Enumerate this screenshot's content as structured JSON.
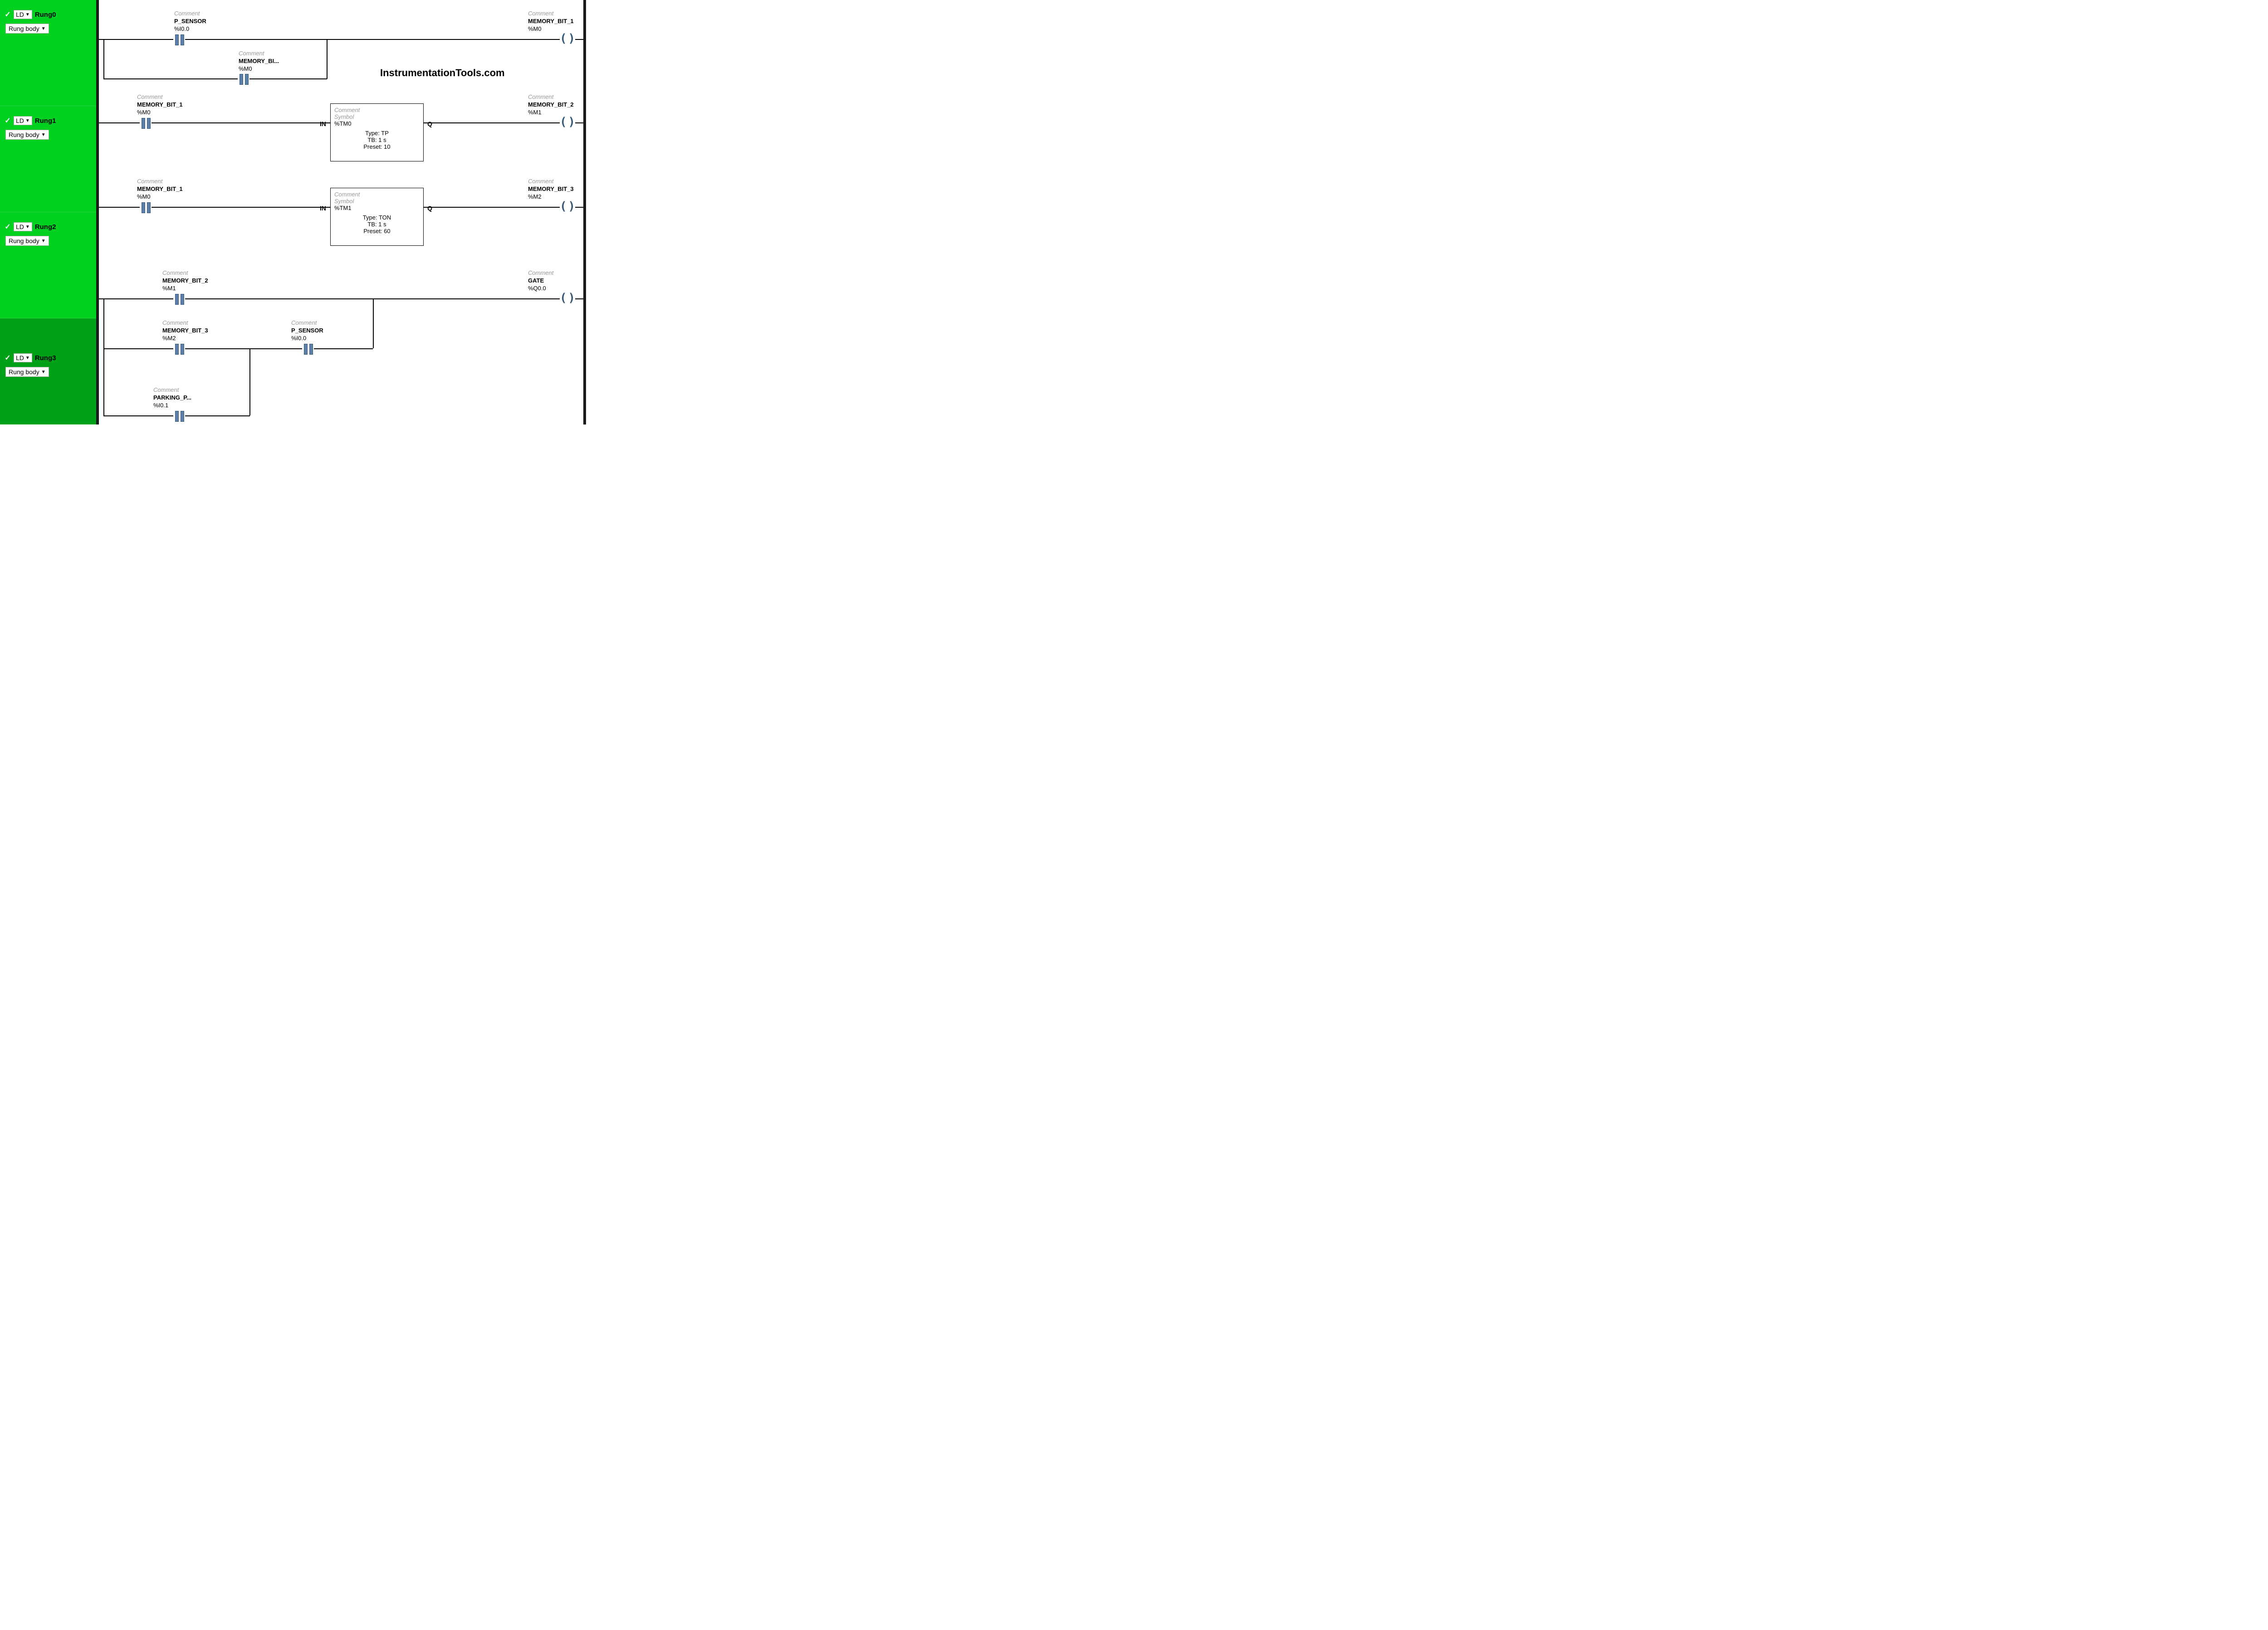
{
  "sidebar": {
    "ld_label": "LD",
    "body_label": "Rung body",
    "rungs": [
      {
        "name": "Rung0",
        "dark": false
      },
      {
        "name": "Rung1",
        "dark": false
      },
      {
        "name": "Rung2",
        "dark": false
      },
      {
        "name": "Rung3",
        "dark": true
      }
    ]
  },
  "watermark": "InstrumentationTools.com",
  "labels": {
    "comment": "Comment",
    "symbol": "Symbol"
  },
  "rung0": {
    "contact1": {
      "symbol": "P_SENSOR",
      "addr": "%I0.0"
    },
    "contact2": {
      "symbol": "MEMORY_BI...",
      "addr": "%M0"
    },
    "coil": {
      "symbol": "MEMORY_BIT_1",
      "addr": "%M0"
    }
  },
  "rung1": {
    "contact1": {
      "symbol": "MEMORY_BIT_1",
      "addr": "%M0"
    },
    "timer": {
      "addr": "%TM0",
      "type_line": "Type:  TP",
      "tb_line": "TB:  1 s",
      "preset_line": "Preset:  10",
      "in": "IN",
      "q": "Q"
    },
    "coil": {
      "symbol": "MEMORY_BIT_2",
      "addr": "%M1"
    }
  },
  "rung2": {
    "contact1": {
      "symbol": "MEMORY_BIT_1",
      "addr": "%M0"
    },
    "timer": {
      "addr": "%TM1",
      "type_line": "Type:  TON",
      "tb_line": "TB:  1 s",
      "preset_line": "Preset:  60",
      "in": "IN",
      "q": "Q"
    },
    "coil": {
      "symbol": "MEMORY_BIT_3",
      "addr": "%M2"
    }
  },
  "rung3": {
    "contact1": {
      "symbol": "MEMORY_BIT_2",
      "addr": "%M1"
    },
    "contact2": {
      "symbol": "MEMORY_BIT_3",
      "addr": "%M2"
    },
    "contact3": {
      "symbol": "P_SENSOR",
      "addr": "%I0.0"
    },
    "contact4": {
      "symbol": "PARKING_P...",
      "addr": "%I0.1"
    },
    "coil": {
      "symbol": "GATE",
      "addr": "%Q0.0"
    }
  }
}
